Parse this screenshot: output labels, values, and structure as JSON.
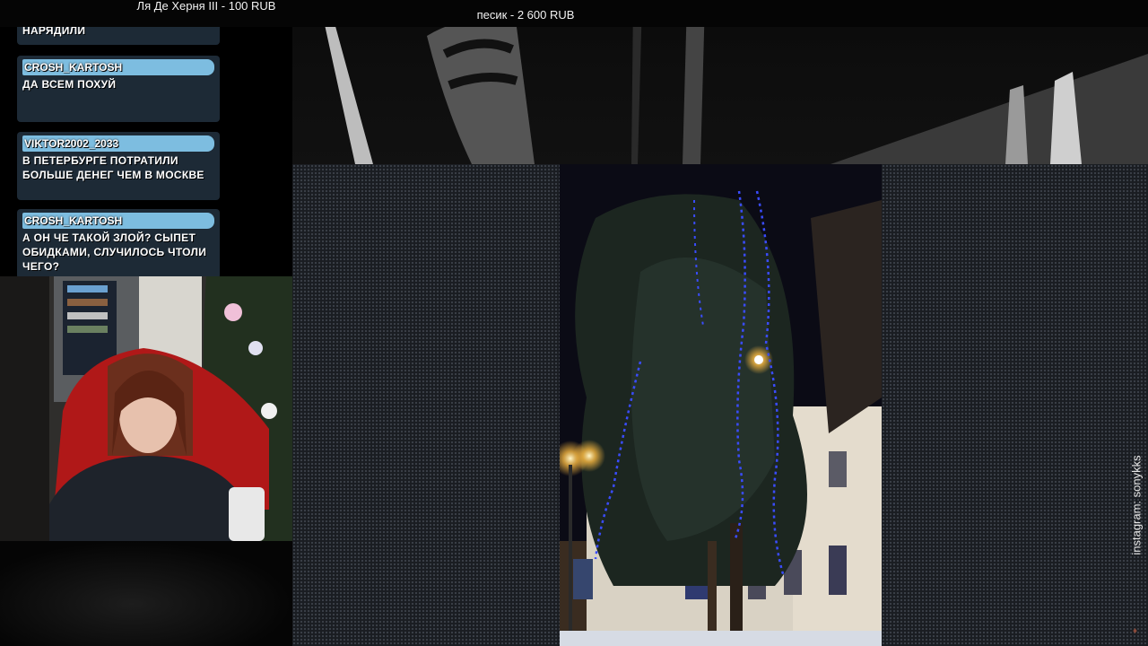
{
  "ticker": {
    "item1": "Ля Де Херня III - 100 RUB",
    "item2": "песик - 2 600 RUB"
  },
  "chat": {
    "messages": [
      {
        "user": "",
        "text": "НАРЯДИЛИ"
      },
      {
        "user": "CROSH_KARTOSH",
        "text": "ДА ВСЕМ ПОХУЙ"
      },
      {
        "user": "VIKTOR2002_2033",
        "text": "В ПЕТЕРБУРГЕ ПОТРАТИЛИ БОЛЬШЕ ДЕНЕГ ЧЕМ В МОСКВЕ"
      },
      {
        "user": "CROSH_KARTOSH",
        "text": "А ОН ЧЕ ТАКОЙ ЗЛОЙ? СЫПЕТ ОБИДКАМИ, СЛУЧИЛОСЬ ЧТОЛИ ЧЕГО?"
      }
    ],
    "username_color": "#7dbde0",
    "bubble_color": "#1d2a36"
  },
  "watermark": "instagram: sonykks",
  "corner_icon": "shield-icon"
}
